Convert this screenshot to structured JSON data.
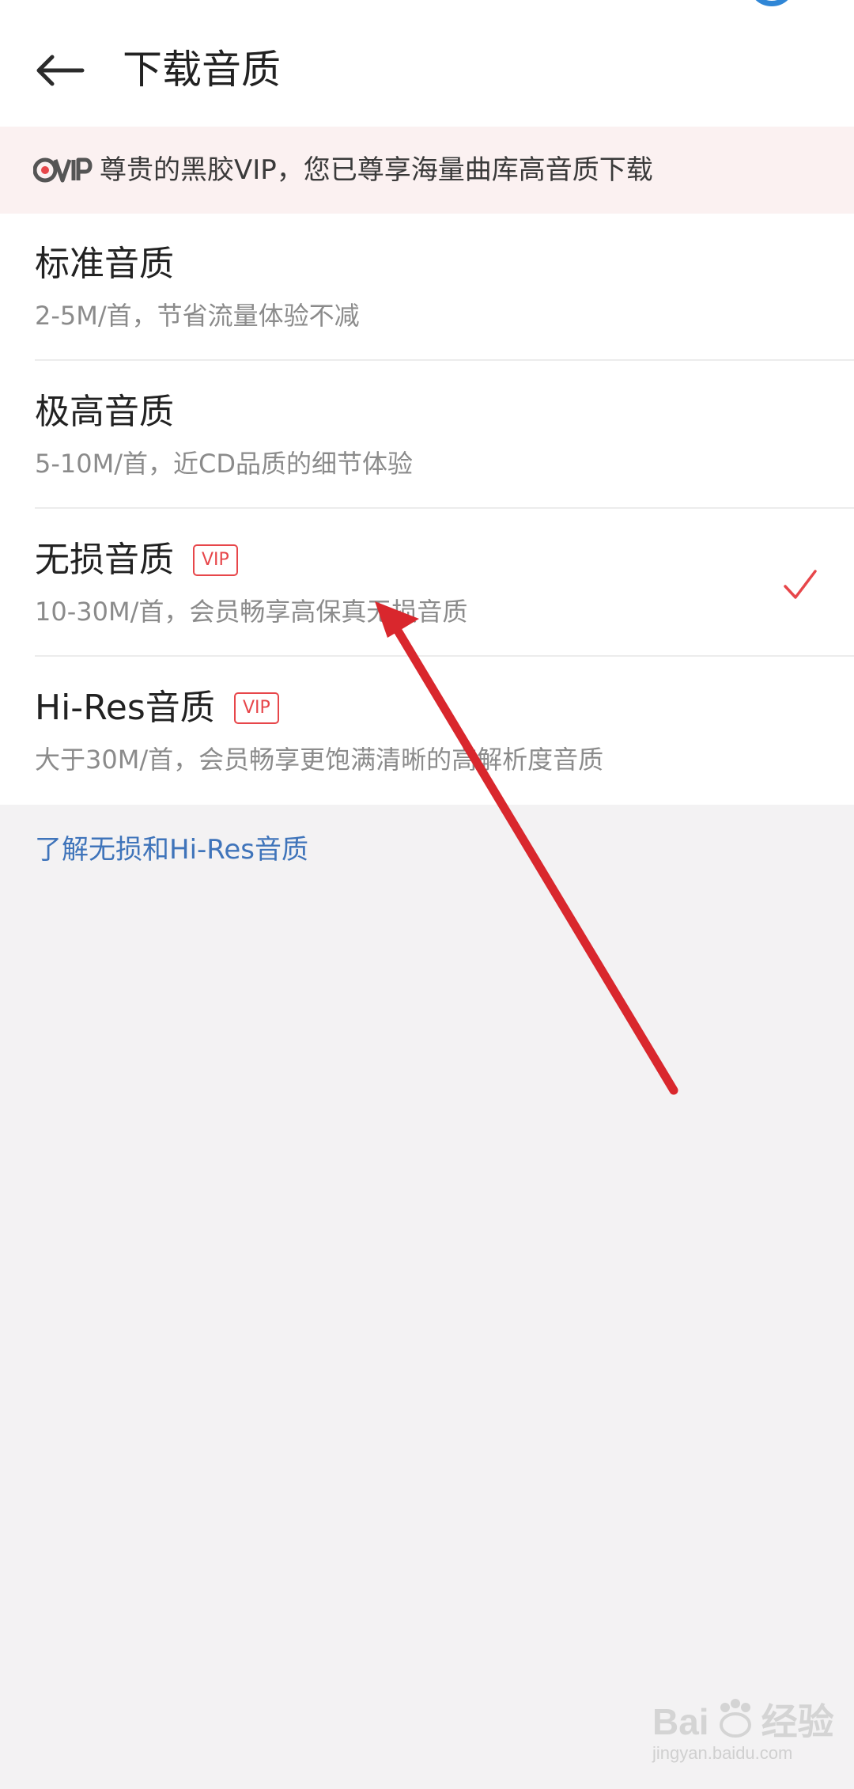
{
  "header": {
    "title": "下载音质",
    "back_icon": "back-arrow-icon"
  },
  "vip_banner": {
    "logo_text": "CVIP",
    "message": "尊贵的黑胶VIP，您已尊享海量曲库高音质下载"
  },
  "qualities": [
    {
      "title": "标准音质",
      "subtitle": "2-5M/首，节省流量体验不减",
      "vip_badge": "",
      "selected": false
    },
    {
      "title": "极高音质",
      "subtitle": "5-10M/首，近CD品质的细节体验",
      "vip_badge": "",
      "selected": false
    },
    {
      "title": "无损音质",
      "subtitle": "10-30M/首，会员畅享高保真无损音质",
      "vip_badge": "VIP",
      "selected": true
    },
    {
      "title": "Hi-Res音质",
      "subtitle": "大于30M/首，会员畅享更饱满清晰的高解析度音质",
      "vip_badge": "VIP",
      "selected": false
    }
  ],
  "learn_more": "了解无损和Hi-Res音质",
  "watermark": {
    "main_left": "Bai",
    "main_right": "经验",
    "main_mid": "du",
    "sub": "jingyan.baidu.com"
  },
  "colors": {
    "accent_red": "#e7464a",
    "link_blue": "#3f74ba",
    "banner_bg": "#fbf1f1",
    "page_bg": "#f3f2f3"
  }
}
